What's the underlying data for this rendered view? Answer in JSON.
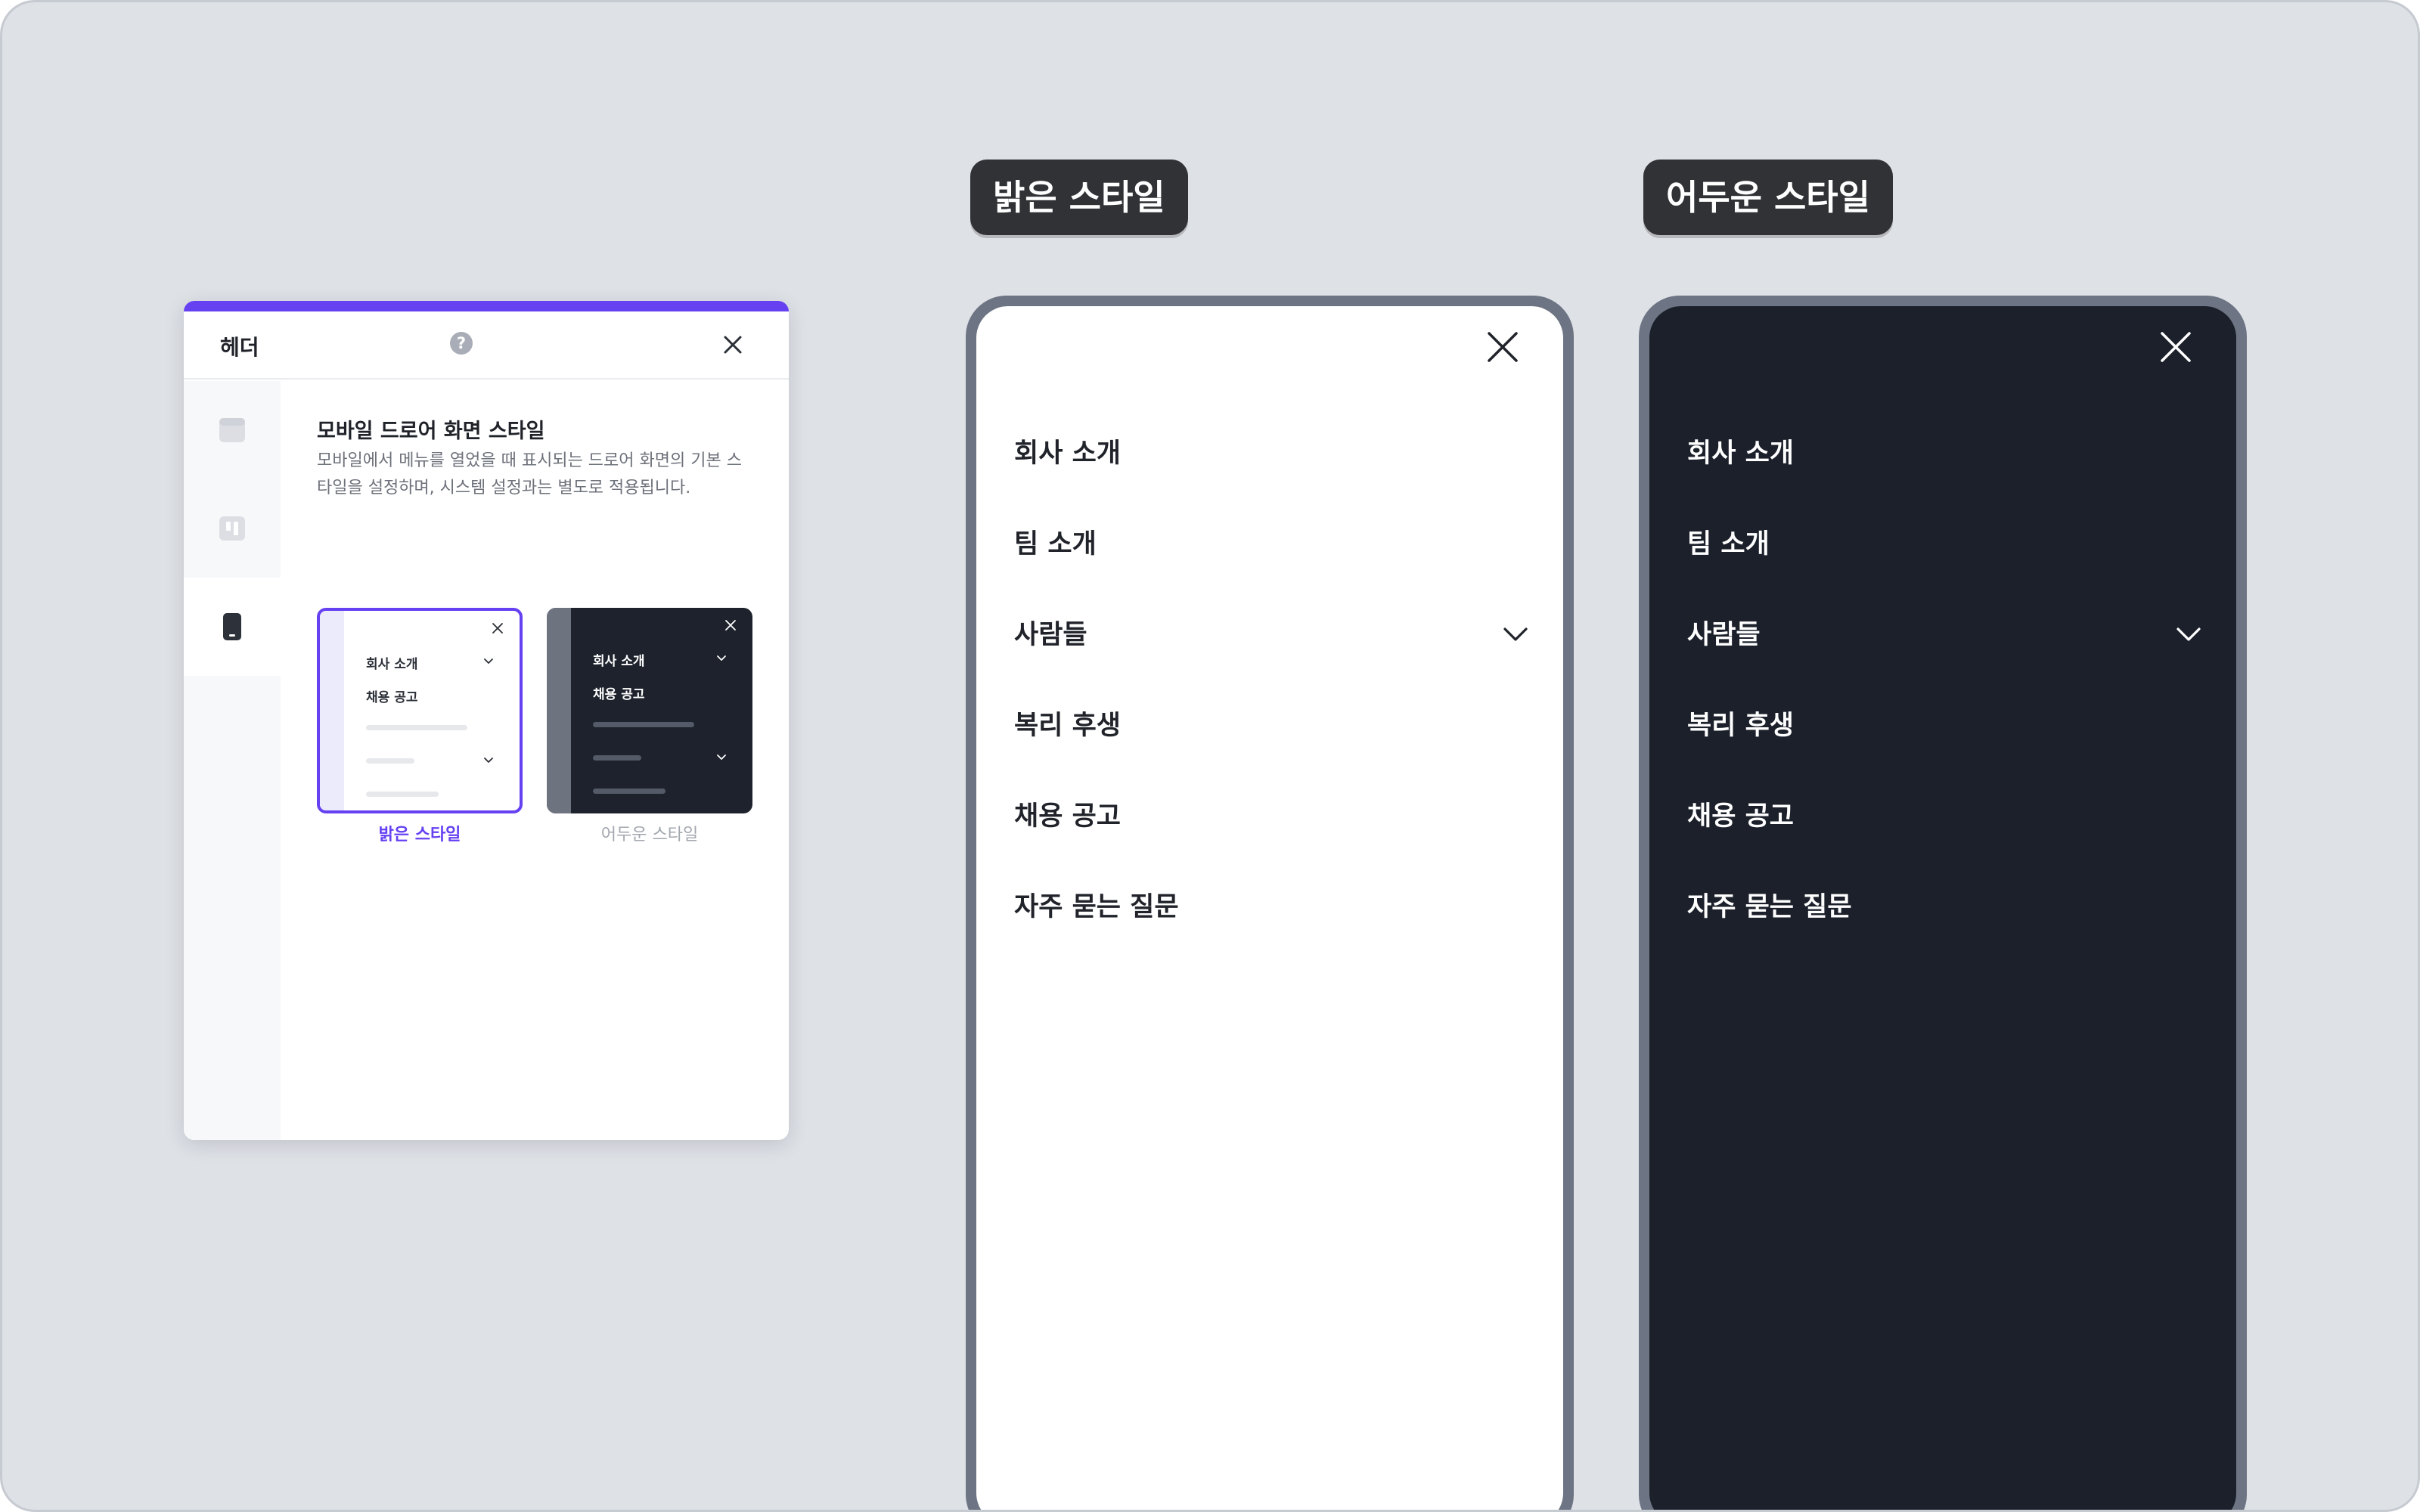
{
  "panel": {
    "title": "헤더",
    "help_icon": "?",
    "section_title": "모바일 드로어 화면 스타일",
    "section_description": "모바일에서 메뉴를 열었을 때 표시되는 드로어 화면의 기본 스타일을 설정하며, 시스템 설정과는 별도로 적용됩니다.",
    "sidebar_items": [
      {
        "icon": "header-layout-icon",
        "selected": false
      },
      {
        "icon": "columns-layout-icon",
        "selected": false
      },
      {
        "icon": "mobile-phone-icon",
        "selected": true
      }
    ],
    "options": [
      {
        "label": "밝은 스타일",
        "selected": true,
        "preview_items": [
          "회사 소개",
          "채용 공고"
        ]
      },
      {
        "label": "어두운 스타일",
        "selected": false,
        "preview_items": [
          "회사 소개",
          "채용 공고"
        ]
      }
    ]
  },
  "previews": {
    "light": {
      "badge": "밝은 스타일",
      "menu": [
        "회사 소개",
        "팀 소개",
        "사람들",
        "복리 후생",
        "채용 공고",
        "자주 묻는 질문"
      ]
    },
    "dark": {
      "badge": "어두운 스타일",
      "menu": [
        "회사 소개",
        "팀 소개",
        "사람들",
        "복리 후생",
        "채용 공고",
        "자주 묻는 질문"
      ]
    },
    "expandable_item_index": 2
  },
  "colors": {
    "accent": "#6541f2",
    "background": "#dee1e6",
    "dark_screen": "#1b202b",
    "phone_frame": "#6d7483",
    "badge": "#303236"
  }
}
